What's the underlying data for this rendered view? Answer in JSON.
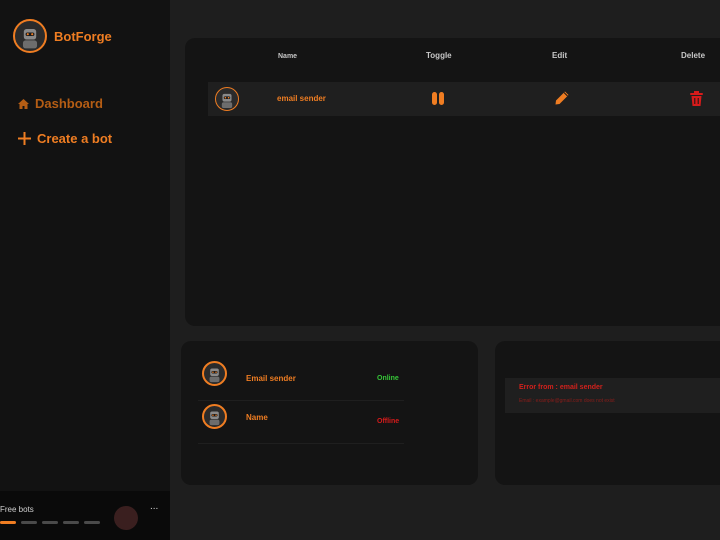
{
  "brand": {
    "name": "BotForge",
    "logo_icon": "robot-icon"
  },
  "nav": {
    "dashboard": {
      "label": "Dashboard",
      "icon": "home-icon"
    },
    "create": {
      "label": "Create a bot",
      "icon": "plus-icon"
    }
  },
  "free_bots": {
    "label": "Free bots",
    "more": "...",
    "slots_total": 5,
    "slots_used": 1
  },
  "table": {
    "columns": {
      "name": "Name",
      "toggle": "Toggle",
      "edit": "Edit",
      "delete": "Delete"
    },
    "rows": [
      {
        "name": "email sender",
        "toggle_icon": "pause-icon",
        "edit_icon": "pencil-icon",
        "delete_icon": "trash-icon"
      }
    ]
  },
  "status": {
    "items": [
      {
        "name": "Email sender",
        "state": "Online"
      },
      {
        "name": "Name",
        "state": "Offline"
      }
    ]
  },
  "errors": {
    "items": [
      {
        "title": "Error from : email sender",
        "detail": "Email : example@gmail.com does not exist"
      }
    ]
  },
  "colors": {
    "accent": "#ef7d22",
    "online": "#35c637",
    "offline": "#d61b1b",
    "error": "#d0211c"
  }
}
